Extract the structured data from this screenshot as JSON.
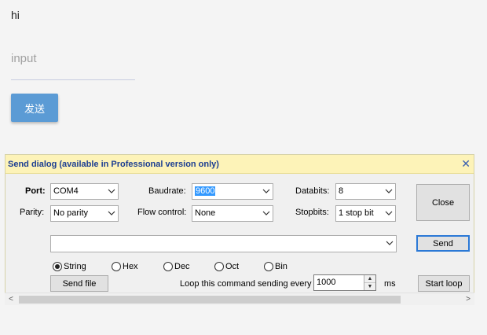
{
  "web": {
    "greeting": "hi",
    "input_placeholder": "input",
    "send_label": "发送"
  },
  "dialog": {
    "title": "Send dialog (available in Professional version only)",
    "close_x": "✕",
    "port": {
      "label": "Port:",
      "value": "COM4"
    },
    "baudrate": {
      "label": "Baudrate:",
      "value": "9600"
    },
    "databits": {
      "label": "Databits:",
      "value": "8"
    },
    "parity": {
      "label": "Parity:",
      "value": "No parity"
    },
    "flow": {
      "label": "Flow control:",
      "value": "None"
    },
    "stopbits": {
      "label": "Stopbits:",
      "value": "1 stop bit"
    },
    "close_label": "Close",
    "send_label": "Send",
    "command_value": "",
    "formats": [
      {
        "label": "String",
        "checked": true
      },
      {
        "label": "Hex",
        "checked": false
      },
      {
        "label": "Dec",
        "checked": false
      },
      {
        "label": "Oct",
        "checked": false
      },
      {
        "label": "Bin",
        "checked": false
      }
    ],
    "send_file_label": "Send file",
    "loop_label": "Loop this command sending every",
    "loop_value": "1000",
    "loop_unit": "ms",
    "start_loop_label": "Start loop"
  }
}
